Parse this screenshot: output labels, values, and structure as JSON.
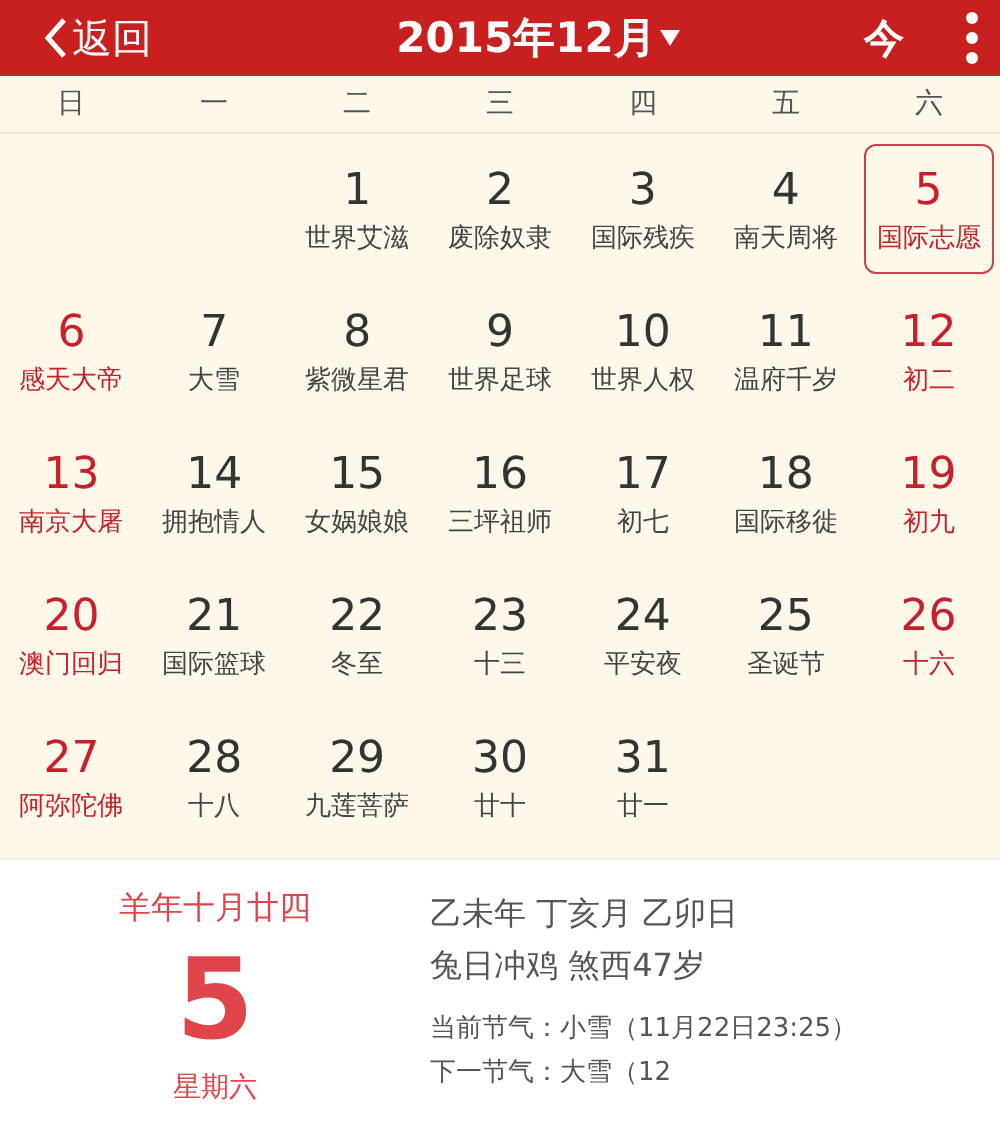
{
  "header": {
    "back": "返回",
    "title": "2015年12月",
    "today": "今"
  },
  "weekdays": [
    "日",
    "一",
    "二",
    "三",
    "四",
    "五",
    "六"
  ],
  "weeks": [
    {
      "kind": "first",
      "days": [
        {
          "day": "1",
          "note": "世界艾滋",
          "weekend": false,
          "selected": false
        },
        {
          "day": "2",
          "note": "废除奴隶",
          "weekend": false,
          "selected": false
        },
        {
          "day": "3",
          "note": "国际残疾",
          "weekend": false,
          "selected": false
        },
        {
          "day": "4",
          "note": "南天周将",
          "weekend": false,
          "selected": false
        },
        {
          "day": "5",
          "note": "国际志愿",
          "weekend": true,
          "selected": true
        }
      ]
    },
    {
      "days": [
        {
          "day": "6",
          "note": "感天大帝",
          "weekend": true,
          "selected": false
        },
        {
          "day": "7",
          "note": "大雪",
          "weekend": false,
          "selected": false
        },
        {
          "day": "8",
          "note": "紫微星君",
          "weekend": false,
          "selected": false
        },
        {
          "day": "9",
          "note": "世界足球",
          "weekend": false,
          "selected": false
        },
        {
          "day": "10",
          "note": "世界人权",
          "weekend": false,
          "selected": false
        },
        {
          "day": "11",
          "note": "温府千岁",
          "weekend": false,
          "selected": false
        },
        {
          "day": "12",
          "note": "初二",
          "weekend": true,
          "selected": false
        }
      ]
    },
    {
      "days": [
        {
          "day": "13",
          "note": "南京大屠",
          "weekend": true,
          "selected": false
        },
        {
          "day": "14",
          "note": "拥抱情人",
          "weekend": false,
          "selected": false
        },
        {
          "day": "15",
          "note": "女娲娘娘",
          "weekend": false,
          "selected": false
        },
        {
          "day": "16",
          "note": "三坪祖师",
          "weekend": false,
          "selected": false
        },
        {
          "day": "17",
          "note": "初七",
          "weekend": false,
          "selected": false
        },
        {
          "day": "18",
          "note": "国际移徙",
          "weekend": false,
          "selected": false
        },
        {
          "day": "19",
          "note": "初九",
          "weekend": true,
          "selected": false
        }
      ]
    },
    {
      "days": [
        {
          "day": "20",
          "note": "澳门回归",
          "weekend": true,
          "selected": false
        },
        {
          "day": "21",
          "note": "国际篮球",
          "weekend": false,
          "selected": false
        },
        {
          "day": "22",
          "note": "冬至",
          "weekend": false,
          "selected": false
        },
        {
          "day": "23",
          "note": "十三",
          "weekend": false,
          "selected": false
        },
        {
          "day": "24",
          "note": "平安夜",
          "weekend": false,
          "selected": false
        },
        {
          "day": "25",
          "note": "圣诞节",
          "weekend": false,
          "selected": false
        },
        {
          "day": "26",
          "note": "十六",
          "weekend": true,
          "selected": false
        }
      ]
    },
    {
      "kind": "last",
      "days": [
        {
          "day": "27",
          "note": "阿弥陀佛",
          "weekend": true,
          "selected": false
        },
        {
          "day": "28",
          "note": "十八",
          "weekend": false,
          "selected": false
        },
        {
          "day": "29",
          "note": "九莲菩萨",
          "weekend": false,
          "selected": false
        },
        {
          "day": "30",
          "note": "廿十",
          "weekend": false,
          "selected": false
        },
        {
          "day": "31",
          "note": "廿一",
          "weekend": false,
          "selected": false
        }
      ]
    }
  ],
  "detail": {
    "lunar_date": "羊年十月廿四",
    "day": "5",
    "weekday": "星期六",
    "ganzhi": "乙未年 丁亥月 乙卯日",
    "clash": "兔日冲鸡 煞西47岁",
    "current_term": "当前节气：小雪（11月22日23:25）",
    "next_term": "下一节气：大雪（12"
  }
}
